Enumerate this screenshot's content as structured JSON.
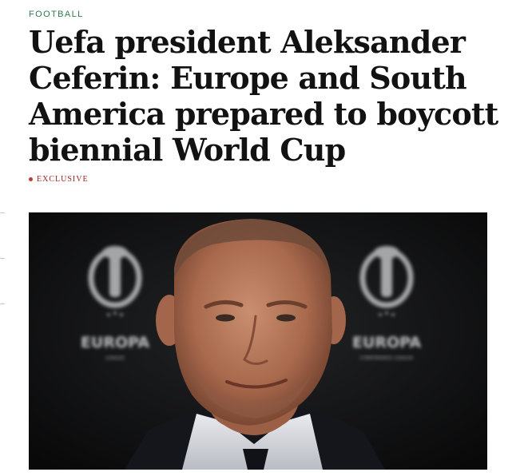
{
  "article": {
    "section": "FOOTBALL",
    "headline": "Uefa president Aleksander Ceferin: Europe and South America prepared to boycott biennial World Cup",
    "tag": "EXCLUSIVE"
  },
  "photo": {
    "backdrop_logo_text": "EUROPA",
    "backdrop_logo_subtext_left": "LEAGUE",
    "backdrop_logo_subtext_right": "CONFERENCE LEAGUE"
  },
  "colors": {
    "section": "#2f7a4f",
    "tag": "#a01f1f",
    "headline": "#121212"
  }
}
